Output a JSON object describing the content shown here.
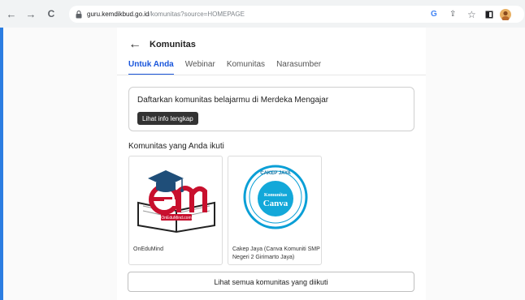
{
  "browser": {
    "url_host": "guru.kemdikbud.go.id",
    "url_path": "/komunitas?source=HOMEPAGE",
    "back_glyph": "←",
    "forward_glyph": "→",
    "reload_glyph": "C",
    "google_glyph": "G",
    "share_glyph": "⇪",
    "star_glyph": "☆"
  },
  "header": {
    "back_glyph": "←",
    "title": "Komunitas"
  },
  "tabs": [
    {
      "label": "Untuk Anda",
      "active": true
    },
    {
      "label": "Webinar",
      "active": false
    },
    {
      "label": "Komunitas",
      "active": false
    },
    {
      "label": "Narasumber",
      "active": false
    }
  ],
  "banner": {
    "text": "Daftarkan komunitas belajarmu di Merdeka Mengajar",
    "button_label": "Lihat info lengkap"
  },
  "section": {
    "title": "Komunitas yang Anda ikuti"
  },
  "communities": [
    {
      "name": "OnEduMind",
      "logo_text": "OnEduMind.com"
    },
    {
      "name": "Cakep Jaya (Canva Komuniti SMP Negeri 2 Girimarto Jaya)",
      "logo_top": "CAKEP JAYA",
      "logo_mid": "Komunitas",
      "logo_main": "Canva"
    }
  ],
  "footer": {
    "all_button_label": "Lihat semua komunitas yang diikuti"
  },
  "colors": {
    "accent": "#1a56db",
    "edge": "#2b7de1"
  }
}
